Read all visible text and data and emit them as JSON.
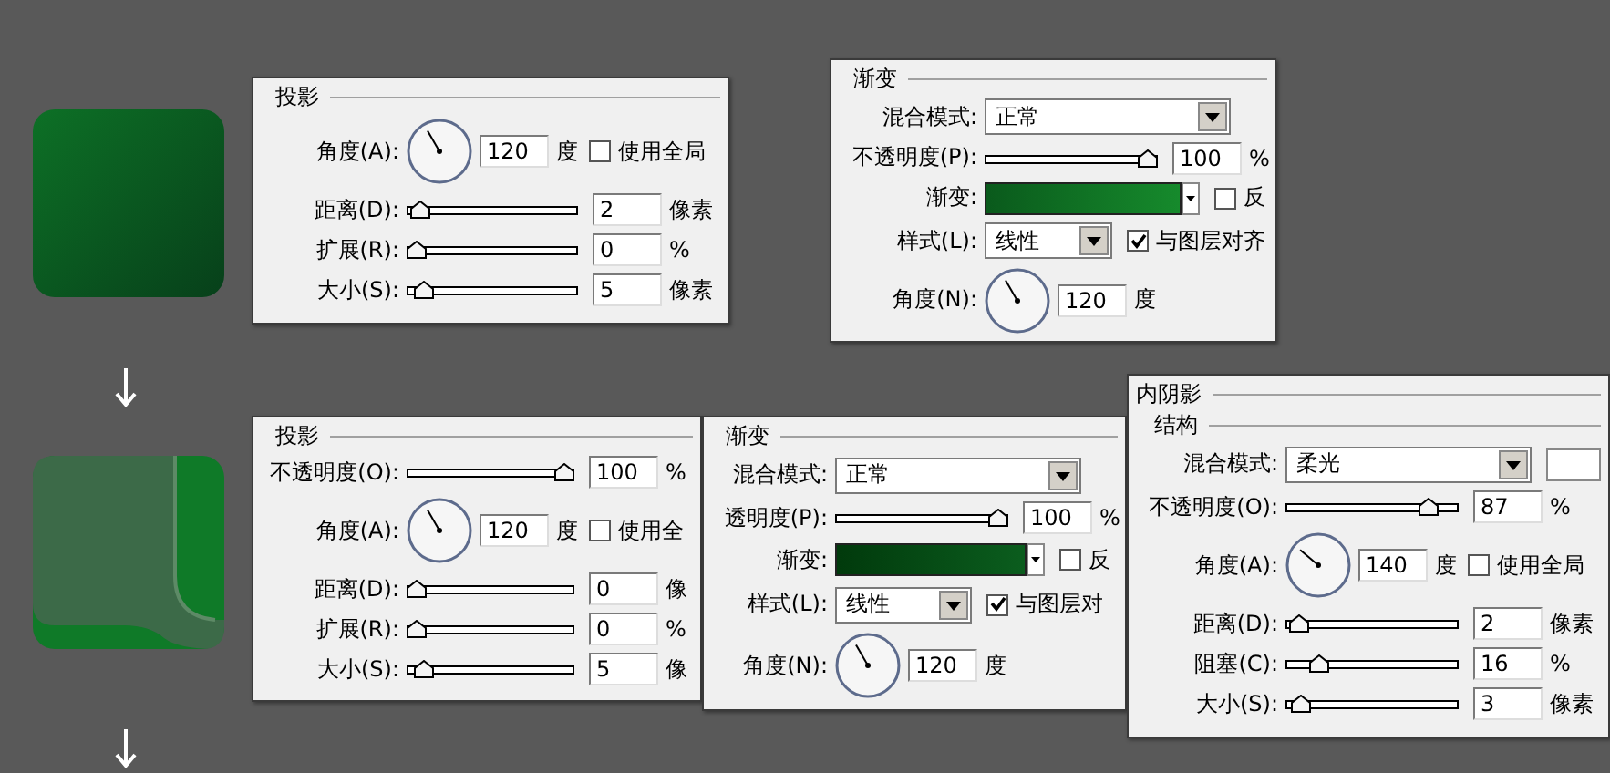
{
  "panels": [
    {
      "title": "投影",
      "rows": [
        {
          "kind": "dial",
          "label": "角度(A):",
          "value": "120",
          "unit": "度",
          "checkbox": {
            "label": "使用全局",
            "checked": false
          }
        },
        {
          "kind": "slider",
          "label": "距离(D):",
          "level": 0.02,
          "value": "2",
          "unit": "像素"
        },
        {
          "kind": "slider",
          "label": "扩展(R):",
          "level": 0,
          "value": "0",
          "unit": "%"
        },
        {
          "kind": "slider",
          "label": "大小(S):",
          "level": 0.05,
          "value": "5",
          "unit": "像素"
        }
      ]
    },
    {
      "title": "渐变",
      "rows": [
        {
          "kind": "select",
          "label": "混合模式:",
          "value": "正常"
        },
        {
          "kind": "slider",
          "label": "不透明度(P):",
          "level": 1,
          "value": "100",
          "unit": "%"
        },
        {
          "kind": "gradient",
          "label": "渐变:",
          "checkbox": {
            "label": "反",
            "checked": false
          }
        },
        {
          "kind": "select",
          "label": "样式(L):",
          "value": "线性",
          "checkbox": {
            "label": "与图层对齐",
            "checked": true
          }
        },
        {
          "kind": "dial",
          "label": "角度(N):",
          "value": "120",
          "unit": "度"
        }
      ]
    },
    {
      "title": "投影",
      "rows": [
        {
          "kind": "slider",
          "label": "不透明度(O):",
          "level": 1,
          "value": "100",
          "unit": "%"
        },
        {
          "kind": "dial",
          "label": "角度(A):",
          "value": "120",
          "unit": "度",
          "checkbox": {
            "label": "使用全",
            "checked": false
          }
        },
        {
          "kind": "slider",
          "label": "距离(D):",
          "level": 0,
          "value": "0",
          "unit": "像"
        },
        {
          "kind": "slider",
          "label": "扩展(R):",
          "level": 0,
          "value": "0",
          "unit": "%"
        },
        {
          "kind": "slider",
          "label": "大小(S):",
          "level": 0.05,
          "value": "5",
          "unit": "像"
        }
      ]
    },
    {
      "title": "渐变",
      "rows": [
        {
          "kind": "select",
          "label": "混合模式:",
          "value": "正常"
        },
        {
          "kind": "slider",
          "label": "透明度(P):",
          "level": 1,
          "value": "100",
          "unit": "%"
        },
        {
          "kind": "gradient",
          "label": "渐变:",
          "checkbox": {
            "label": "反",
            "checked": false
          }
        },
        {
          "kind": "select",
          "label": "样式(L):",
          "value": "线性",
          "checkbox": {
            "label": "与图层对",
            "checked": true
          }
        },
        {
          "kind": "dial",
          "label": "角度(N):",
          "value": "120",
          "unit": "度"
        }
      ]
    },
    {
      "title": "内阴影",
      "group": "结构",
      "rows": [
        {
          "kind": "select",
          "label": "混合模式:",
          "value": "柔光",
          "swatch": true
        },
        {
          "kind": "slider",
          "label": "不透明度(O):",
          "level": 0.87,
          "value": "87",
          "unit": "%"
        },
        {
          "kind": "dial",
          "label": "角度(A):",
          "value": "140",
          "unit": "度",
          "checkbox": {
            "label": "使用全局",
            "checked": false
          }
        },
        {
          "kind": "slider",
          "label": "距离(D):",
          "level": 0.02,
          "value": "2",
          "unit": "像素"
        },
        {
          "kind": "slider",
          "label": "阻塞(C):",
          "level": 0.16,
          "value": "16",
          "unit": "%"
        },
        {
          "kind": "slider",
          "label": "大小(S):",
          "level": 0.03,
          "value": "3",
          "unit": "像素"
        }
      ]
    }
  ]
}
